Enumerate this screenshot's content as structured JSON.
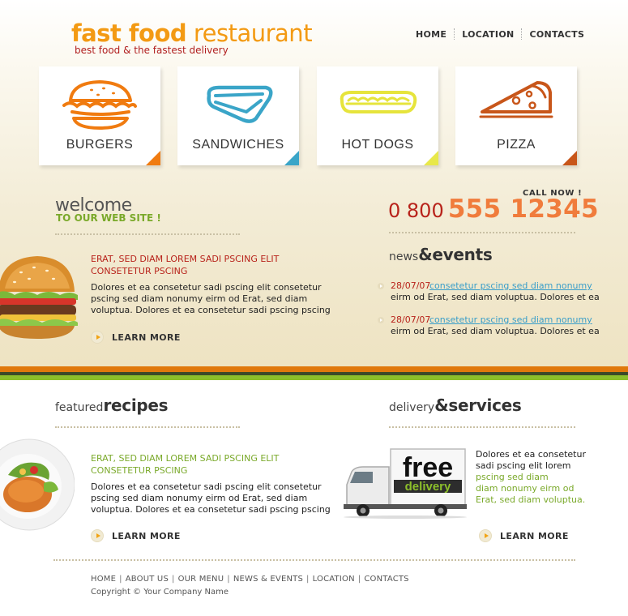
{
  "header": {
    "logo_bold": "fast food",
    "logo_light": "restaurant",
    "tagline": "best food & the fastest delivery",
    "nav": [
      {
        "label": "HOME"
      },
      {
        "label": "LOCATION"
      },
      {
        "label": "CONTACTS"
      }
    ]
  },
  "categories": [
    {
      "label": "BURGERS",
      "icon": "burger-icon",
      "accent": "#f07b10"
    },
    {
      "label": "SANDWICHES",
      "icon": "sandwich-icon",
      "accent": "#3aa5c8"
    },
    {
      "label": "HOT DOGS",
      "icon": "hotdog-icon",
      "accent": "#e8e84a"
    },
    {
      "label": "PIZZA",
      "icon": "pizza-icon",
      "accent": "#c8561a"
    }
  ],
  "welcome": {
    "title": "welcome",
    "subtitle": "TO OUR WEB SITE !",
    "heading_line1": "ERAT, SED DIAM LOREM SADI PSCING ELIT",
    "heading_line2": "CONSETETUR PSCING",
    "body_line1": "Dolores et ea consetetur sadi pscing elit consetetur",
    "body_line2": "pscing sed diam nonumy eirm od Erat, sed diam",
    "body_line3": "voluptua. Dolores et ea consetetur sadi pscing pscing",
    "learn_more": "LEARN MORE"
  },
  "call": {
    "label": "CALL NOW !",
    "prefix": "0 800",
    "number": "555 12345"
  },
  "news": {
    "title_small": "news",
    "title_big": "&events",
    "items": [
      {
        "date": "28/07/07",
        "link": "consetetur pscing sed diam nonumy",
        "text": "eirm od Erat, sed diam voluptua. Dolores et ea"
      },
      {
        "date": "28/07/07",
        "link": "consetetur pscing sed diam nonumy",
        "text": "eirm od Erat, sed diam voluptua. Dolores et ea"
      }
    ]
  },
  "featured": {
    "title_small": "featured",
    "title_big": "recipes",
    "heading_line1": "ERAT, SED DIAM LOREM SADI PSCING ELIT",
    "heading_line2": "CONSETETUR PSCING",
    "body_line1": "Dolores et ea consetetur sadi pscing elit consetetur",
    "body_line2": "pscing sed diam nonumy eirm od Erat, sed diam",
    "body_line3": "voluptua. Dolores et ea consetetur sadi pscing pscing",
    "learn_more": "LEARN MORE"
  },
  "delivery": {
    "title_small": "delivery",
    "title_big": "&services",
    "truck_word1": "free",
    "truck_word2": "delivery",
    "text_line1": "Dolores et ea consetetur",
    "text_line2": "sadi pscing elit lorem",
    "text_line3": "pscing sed diam",
    "text_line4": "diam nonumy eirm od",
    "text_line5": "Erat, sed diam voluptua.",
    "learn_more": "LEARN MORE"
  },
  "footer": {
    "links": [
      "HOME",
      "ABOUT US",
      "OUR MENU",
      "NEWS & EVENTS",
      "LOCATION",
      "CONTACTS"
    ],
    "separator": "|",
    "copyright": "Copyright © Your Company Name"
  }
}
